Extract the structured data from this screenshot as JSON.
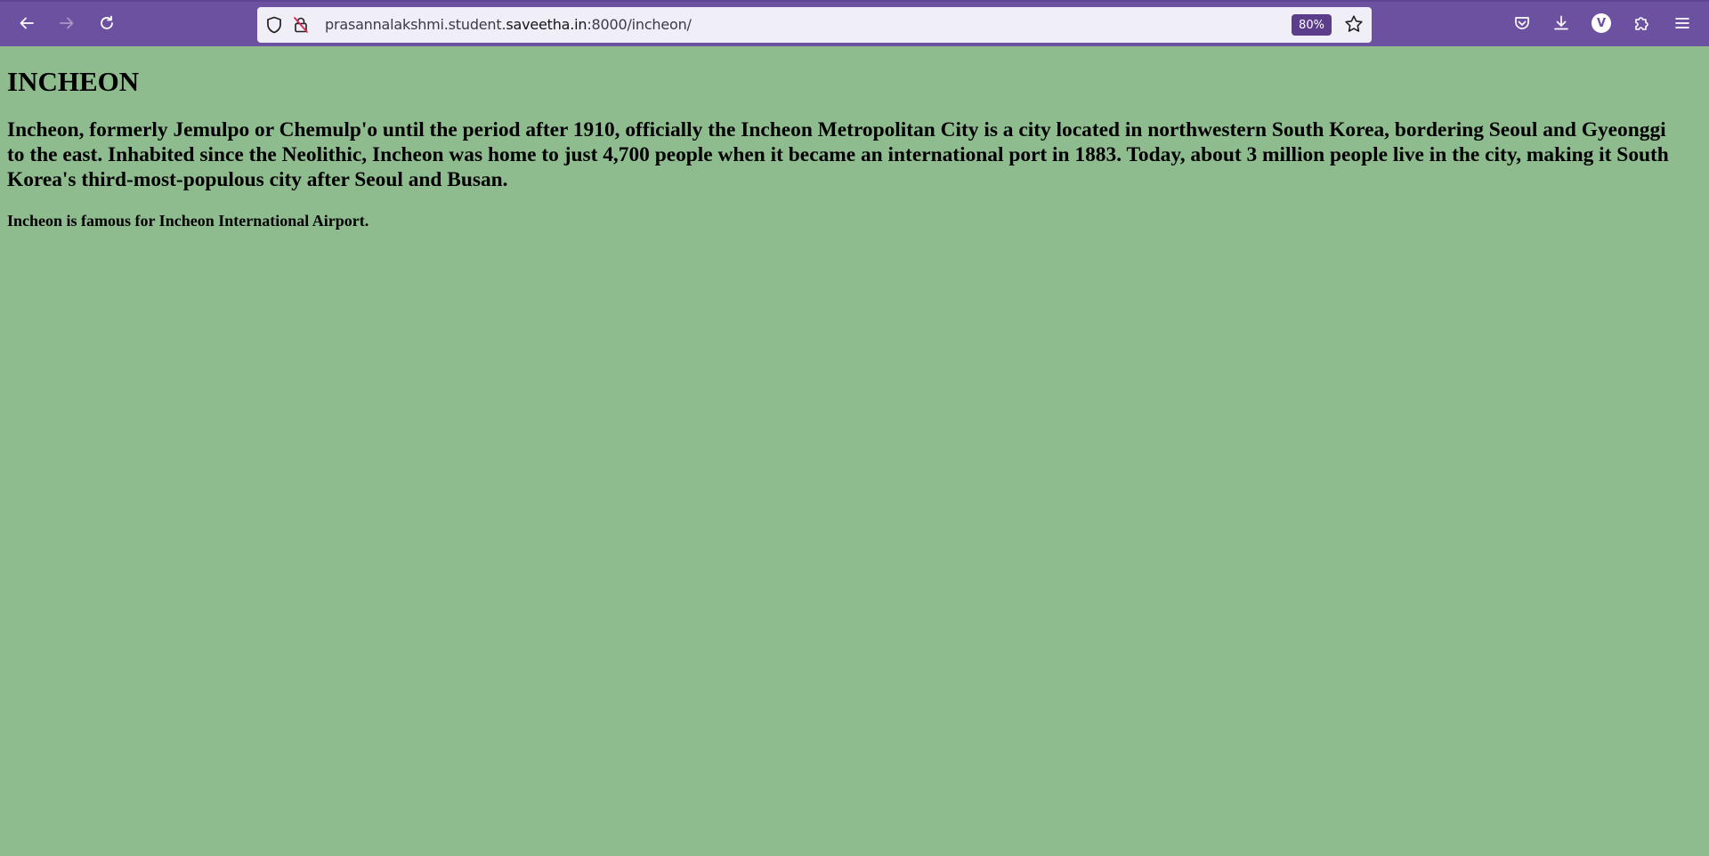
{
  "browser": {
    "url_prefix": "prasannalakshmi.student.",
    "url_host": "saveetha.in",
    "url_suffix": ":8000/incheon/",
    "zoom": "80%",
    "profile_initial": "V"
  },
  "icons": {
    "back": "arrow-left-icon",
    "forward": "arrow-right-icon",
    "reload": "reload-icon",
    "tracking": "shield-icon",
    "insecure": "insecure-lock-icon",
    "bookmark": "star-icon",
    "pocket": "pocket-icon",
    "downloads": "download-icon",
    "extensions": "puzzle-icon",
    "menu": "hamburger-menu-icon"
  },
  "colors": {
    "toolbar": "#6d51a1",
    "urlbar": "#f0eef6",
    "zoom_badge": "#5b3d8c",
    "page_background": "#8fbc8f"
  },
  "page": {
    "heading": "INCHEON",
    "lead": "Incheon, formerly Jemulpo or Chemulp'o until the period after 1910, officially the Incheon Metropolitan City is a city located in northwestern South Korea, bordering Seoul and Gyeonggi to the east. Inhabited since the Neolithic, Incheon was home to just 4,700 people when it became an international port in 1883. Today, about 3 million people live in the city, making it South Korea's third-most-populous city after Seoul and Busan.",
    "note": "Incheon is famous for Incheon International Airport."
  }
}
